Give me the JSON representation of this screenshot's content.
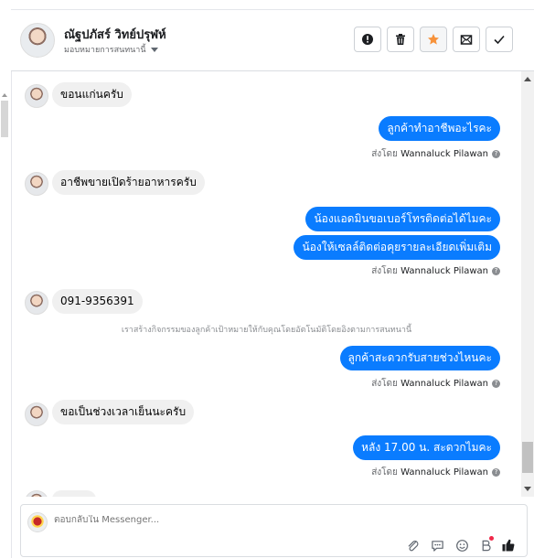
{
  "header": {
    "name": "ณัฐปภัสร์ วิทย์ปรุฬห์",
    "assign_label": "มอบหมายการสนทนานี้",
    "actions": [
      "mark-spam",
      "delete",
      "star",
      "mark-unread",
      "done"
    ]
  },
  "messages": [
    {
      "dir": "in",
      "text": "ขอนแก่นครับ"
    },
    {
      "dir": "out",
      "text": "ลูกค้าทำอาชีพอะไรคะ"
    },
    {
      "dir": "sent_by",
      "prefix": "ส่งโดย",
      "name": "Wannaluck Pilawan"
    },
    {
      "dir": "in",
      "text": "อาชีพขายเปิดร้ายอาหารครับ"
    },
    {
      "dir": "out",
      "text": "น้องแอดมินขอเบอร์โทรติดต่อได้ไมคะ"
    },
    {
      "dir": "out",
      "text": "น้องให้เซลล์ติดต่อคุยรายละเอียดเพิ่มเติม"
    },
    {
      "dir": "sent_by",
      "prefix": "ส่งโดย",
      "name": "Wannaluck Pilawan"
    },
    {
      "dir": "in",
      "text": "091-9356391"
    },
    {
      "dir": "system",
      "text": "เราสร้างกิจกรรมของลูกค้าเป้าหมายให้กับคุณโดยอัตโนมัติโดยอิงตามการสนทนานี้"
    },
    {
      "dir": "out",
      "text": "ลูกค้าสะดวกรับสายช่วงไหนคะ"
    },
    {
      "dir": "sent_by",
      "prefix": "ส่งโดย",
      "name": "Wannaluck Pilawan"
    },
    {
      "dir": "in",
      "text": "ขอเป็นช่วงเวลาเย็นนะครับ"
    },
    {
      "dir": "out",
      "text": "หลัง 17.00 น.  สะดวกไมคะ"
    },
    {
      "dir": "sent_by",
      "prefix": "ส่งโดย",
      "name": "Wannaluck Pilawan"
    }
  ],
  "composer": {
    "placeholder": "ตอบกลับใน Messenger...",
    "icons": [
      "attachment-icon",
      "saved-reply-icon",
      "emoji-icon",
      "bot-icon",
      "like-icon"
    ]
  },
  "colors": {
    "outgoing": "#0a7cff",
    "incoming": "#f0f0f0",
    "accent_star": "#f7923a"
  }
}
